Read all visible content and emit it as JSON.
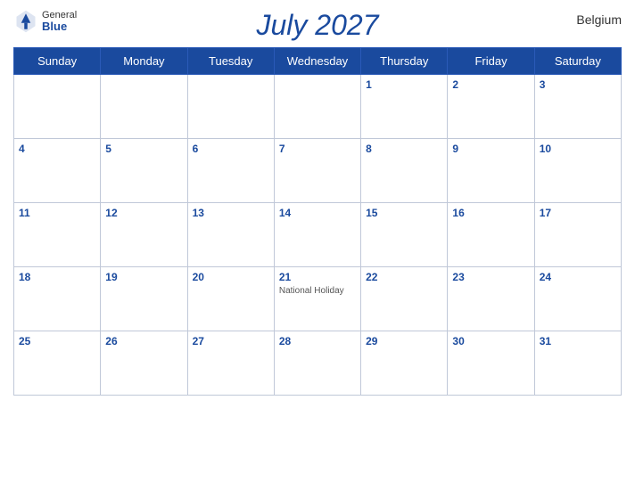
{
  "header": {
    "title": "July 2027",
    "country": "Belgium",
    "logo": {
      "general": "General",
      "blue": "Blue"
    }
  },
  "weekdays": [
    "Sunday",
    "Monday",
    "Tuesday",
    "Wednesday",
    "Thursday",
    "Friday",
    "Saturday"
  ],
  "weeks": [
    [
      {
        "date": "",
        "events": []
      },
      {
        "date": "",
        "events": []
      },
      {
        "date": "",
        "events": []
      },
      {
        "date": "",
        "events": []
      },
      {
        "date": "1",
        "events": []
      },
      {
        "date": "2",
        "events": []
      },
      {
        "date": "3",
        "events": []
      }
    ],
    [
      {
        "date": "4",
        "events": []
      },
      {
        "date": "5",
        "events": []
      },
      {
        "date": "6",
        "events": []
      },
      {
        "date": "7",
        "events": []
      },
      {
        "date": "8",
        "events": []
      },
      {
        "date": "9",
        "events": []
      },
      {
        "date": "10",
        "events": []
      }
    ],
    [
      {
        "date": "11",
        "events": []
      },
      {
        "date": "12",
        "events": []
      },
      {
        "date": "13",
        "events": []
      },
      {
        "date": "14",
        "events": []
      },
      {
        "date": "15",
        "events": []
      },
      {
        "date": "16",
        "events": []
      },
      {
        "date": "17",
        "events": []
      }
    ],
    [
      {
        "date": "18",
        "events": []
      },
      {
        "date": "19",
        "events": []
      },
      {
        "date": "20",
        "events": []
      },
      {
        "date": "21",
        "events": [
          "National Holiday"
        ]
      },
      {
        "date": "22",
        "events": []
      },
      {
        "date": "23",
        "events": []
      },
      {
        "date": "24",
        "events": []
      }
    ],
    [
      {
        "date": "25",
        "events": []
      },
      {
        "date": "26",
        "events": []
      },
      {
        "date": "27",
        "events": []
      },
      {
        "date": "28",
        "events": []
      },
      {
        "date": "29",
        "events": []
      },
      {
        "date": "30",
        "events": []
      },
      {
        "date": "31",
        "events": []
      }
    ]
  ]
}
